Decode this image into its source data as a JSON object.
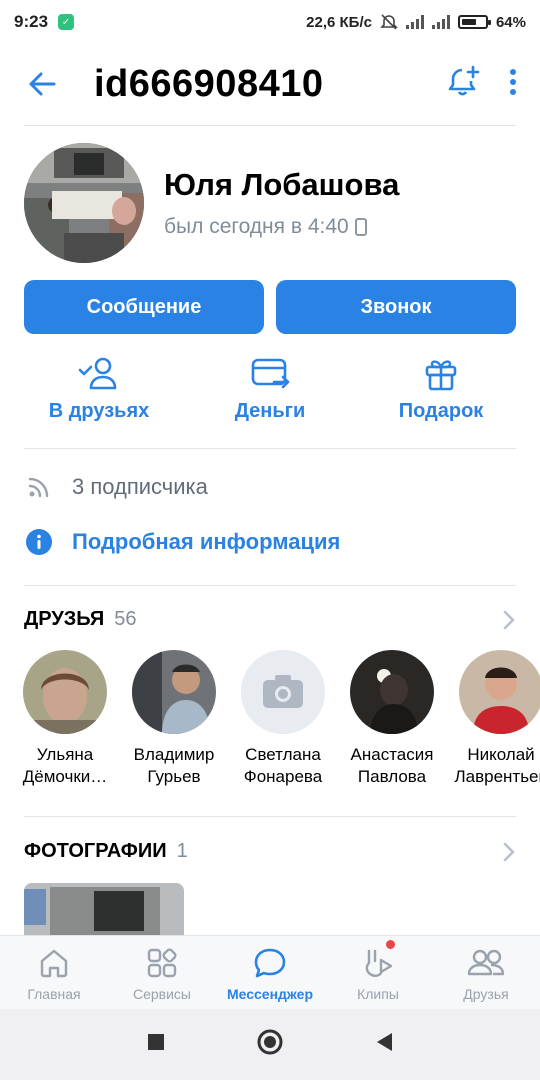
{
  "status_bar": {
    "time": "9:23",
    "network_speed": "22,6 КБ/с",
    "battery": "64%",
    "battery_level": 0.64
  },
  "header": {
    "title": "id666908410"
  },
  "profile": {
    "name": "Юля Лобашова",
    "last_seen": "был сегодня в 4:40"
  },
  "buttons": {
    "message": "Сообщение",
    "call": "Звонок"
  },
  "actions": [
    {
      "label": "В друзьях",
      "icon": "friend-check-icon"
    },
    {
      "label": "Деньги",
      "icon": "money-transfer-icon"
    },
    {
      "label": "Подарок",
      "icon": "gift-icon"
    }
  ],
  "info": {
    "followers": "3 подписчика",
    "details": "Подробная информация"
  },
  "friends_section": {
    "title": "ДРУЗЬЯ",
    "count": "56",
    "items": [
      {
        "line1": "Ульяна",
        "line2": "Дёмочки…"
      },
      {
        "line1": "Владимир",
        "line2": "Гурьев"
      },
      {
        "line1": "Светлана",
        "line2": "Фонарева"
      },
      {
        "line1": "Анастасия",
        "line2": "Павлова"
      },
      {
        "line1": "Николай",
        "line2": "Лаврентьев"
      }
    ]
  },
  "photos_section": {
    "title": "ФОТОГРАФИИ",
    "count": "1"
  },
  "tabbar": [
    {
      "label": "Главная",
      "icon": "home-icon",
      "active": false
    },
    {
      "label": "Сервисы",
      "icon": "services-grid-icon",
      "active": false
    },
    {
      "label": "Мессенджер",
      "icon": "messenger-bubble-icon",
      "active": true
    },
    {
      "label": "Клипы",
      "icon": "clips-icon",
      "active": false
    },
    {
      "label": "Друзья",
      "icon": "friends-icon",
      "active": false
    }
  ],
  "colors": {
    "accent": "#2a82e4",
    "secondary_text": "#818c99",
    "notification_dot": "#e64646"
  }
}
